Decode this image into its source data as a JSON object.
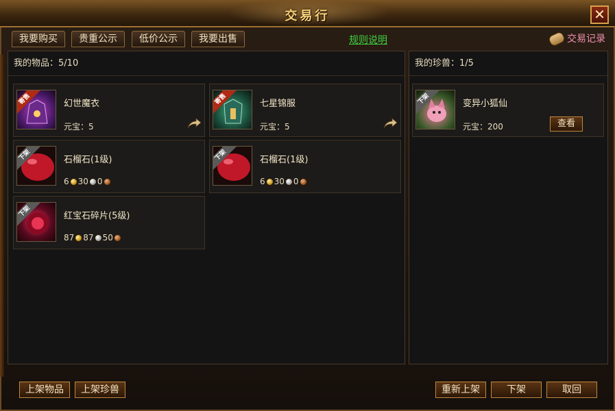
{
  "window": {
    "title": "交易行",
    "close_label": "✕"
  },
  "tabs": [
    {
      "label": "我要购买"
    },
    {
      "label": "贵重公示"
    },
    {
      "label": "低价公示"
    },
    {
      "label": "我要出售"
    }
  ],
  "rules_link": "规则说明",
  "trade_record": "交易记录",
  "items_panel": {
    "header_label": "我的物品：",
    "count": "5/10",
    "cards": [
      {
        "name": "幻世魔衣",
        "price_label": "元宝：",
        "price": "5",
        "badge": "寄售",
        "icon": "robe-icon",
        "colors": [
          "#4a1a6a",
          "#c040c0"
        ]
      },
      {
        "name": "七星锦服",
        "price_label": "元宝：",
        "price": "5",
        "badge": "寄售",
        "icon": "armor-icon",
        "colors": [
          "#1a4a3a",
          "#40b080"
        ]
      },
      {
        "name": "石榴石(1级)",
        "gold": "6",
        "silver": "30",
        "copper": "0",
        "badge": "下架",
        "icon": "garnet-icon",
        "colors": [
          "#6a0a14",
          "#e04050"
        ]
      },
      {
        "name": "石榴石(1级)",
        "gold": "6",
        "silver": "30",
        "copper": "0",
        "badge": "下架",
        "icon": "garnet-icon",
        "colors": [
          "#6a0a14",
          "#e04050"
        ]
      },
      {
        "name": "红宝石碎片(5级)",
        "gold": "87",
        "silver": "87",
        "copper": "50",
        "badge": "下架",
        "icon": "ruby-shard-icon",
        "colors": [
          "#5a0a20",
          "#ff3060"
        ]
      }
    ]
  },
  "pets_panel": {
    "header_label": "我的珍兽：",
    "count": "1/5",
    "cards": [
      {
        "name": "变异小狐仙",
        "price_label": "元宝：",
        "price": "200",
        "badge": "下架",
        "view_label": "查看",
        "icon": "fox-pet-icon",
        "colors": [
          "#3a5a2a",
          "#f080a0"
        ]
      }
    ]
  },
  "buttons": {
    "list_item": "上架物品",
    "list_pet": "上架珍兽",
    "relist": "重新上架",
    "delist": "下架",
    "cancel": "取回"
  }
}
